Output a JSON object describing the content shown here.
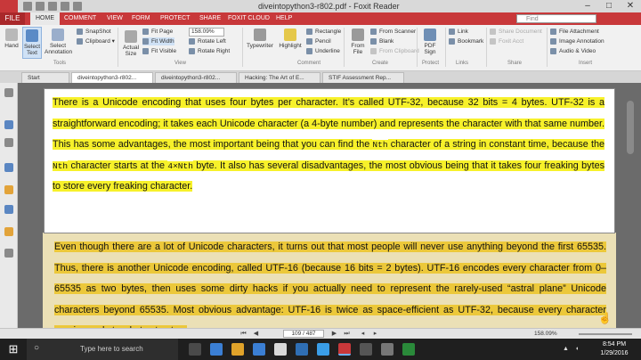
{
  "title_bar": {
    "app_logo": "FXP",
    "title": "diveintopython3-r802.pdf - Foxit Reader",
    "controls": [
      "–",
      "□",
      "✕"
    ]
  },
  "ribbon": {
    "file_tab": "FILE",
    "tabs": [
      "HOME",
      "COMMENT",
      "VIEW",
      "FORM",
      "PROTECT",
      "SHARE",
      "FOXIT CLOUD",
      "HELP"
    ],
    "find_placeholder": "Find",
    "tools": {
      "hand": "Hand",
      "select_text": "Select Text",
      "select_annotation": "Select Annotation",
      "snapshot": "SnapShot",
      "clipboard": "Clipboard ▾",
      "actual_size": "Actual Size",
      "fit_page": "Fit Page",
      "fit_width": "Fit Width",
      "fit_visible": "Fit Visible",
      "zoom_value": "158.09%",
      "rotate_left": "Rotate Left",
      "rotate_right": "Rotate Right",
      "typewriter": "Typewriter",
      "highlight": "Highlight",
      "rectangle": "Rectangle",
      "pencil": "Pencil",
      "underline": "Underline",
      "from_file": "From File",
      "from_scanner": "From Scanner",
      "blank": "Blank",
      "from_clipboard": "From Clipboard",
      "pdf_sign": "PDF Sign",
      "link": "Link",
      "bookmark": "Bookmark",
      "share_document": "Share Document",
      "foxit_acct": "Foxit Acct",
      "file_attachment": "File Attachment",
      "image_annotation": "Image Annotation",
      "audio_video": "Audio & Video"
    },
    "groups": [
      "Tools",
      "View",
      "Comment",
      "Create",
      "Protect",
      "Links",
      "Share",
      "Insert"
    ]
  },
  "doc_tabs": [
    "Start",
    "diveintopython3-r802...",
    "diveintopython3-r802...",
    "Hacking: The Art of E...",
    "STIF Assessment Rep..."
  ],
  "callout": {
    "seg1": "There is a Unicode encoding that uses four bytes per character. It’s called UTF-32, because 32 bits = 4 bytes. UTF-32 is a straightforward encoding; it takes each Unicode character (a 4-byte number) and represents the character with that same number. This has some advantages, the most important being that you can find the ",
    "code1": "Nth",
    "seg2": " character of a string in constant time, because the ",
    "code2": "Nth",
    "seg3": " character starts at the ",
    "code3": "4×Nth",
    "seg4": " byte. It also has several disadvantages, the most obvious being that it takes four freaking bytes to store every freaking character."
  },
  "page_text": "Even though there are a lot of Unicode characters, it turns out that most people will never use anything beyond the first 65535. Thus, there is another Unicode encoding, called UTF-16 (because 16 bits = 2 bytes). UTF-16 encodes every character from 0–65535 as two bytes, then uses some dirty hacks if you actually need to represent the rarely-used “astral plane” Unicode characters beyond 65535. Most obvious advantage: UTF-16 is twice as space-efficient as UTF-32, because every character requires only two bytes to store",
  "status_bar": {
    "page": "109 / 487",
    "zoom": "158.09%"
  },
  "taskbar": {
    "search_text": "Type here to search",
    "time": "8:54 PM",
    "date": "1/29/2016"
  },
  "colors": {
    "ribbon_red": "#c8383a",
    "highlight_yellow": "#f7f12a",
    "page_highlight": "#ecc83a"
  }
}
